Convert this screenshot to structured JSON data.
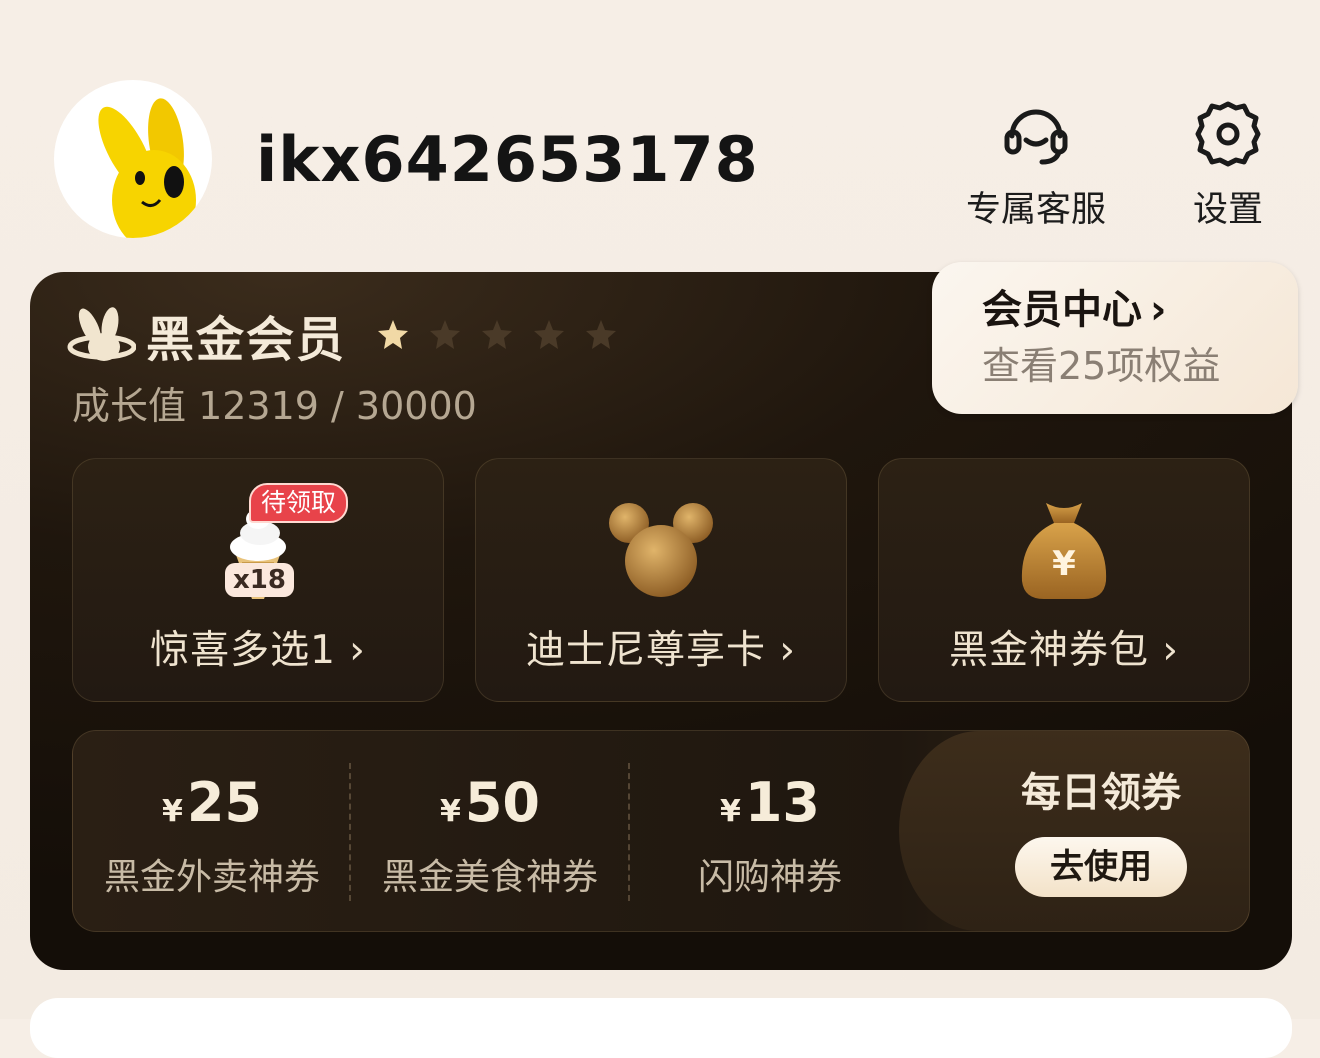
{
  "header": {
    "username": "ikx642653178",
    "actions": [
      {
        "label": "专属客服",
        "icon": "headset-icon"
      },
      {
        "label": "设置",
        "icon": "gear-icon"
      }
    ]
  },
  "membership": {
    "tier_name": "黑金会员",
    "stars_total": 5,
    "stars_filled": 1,
    "growth_text": "成长值 12319 / 30000",
    "member_center": {
      "title": "会员中心",
      "chevron": "›",
      "subtitle": "查看25项权益"
    },
    "benefits": [
      {
        "label": "惊喜多选1 ›",
        "icon": "ice-cream-icon",
        "badge": "待领取",
        "count": "x18"
      },
      {
        "label": "迪士尼尊享卡 ›",
        "icon": "mickey-icon"
      },
      {
        "label": "黑金神券包 ›",
        "icon": "money-bag-icon"
      }
    ],
    "coupons": [
      {
        "currency": "¥",
        "amount": "25",
        "name": "黑金外卖神券"
      },
      {
        "currency": "¥",
        "amount": "50",
        "name": "黑金美食神券"
      },
      {
        "currency": "¥",
        "amount": "13",
        "name": "闪购神券"
      }
    ],
    "daily": {
      "title": "每日领券",
      "button": "去使用"
    }
  },
  "colors": {
    "gold": "#c9a463",
    "card_dark": "#1f160d",
    "badge_red": "#e8434a"
  }
}
